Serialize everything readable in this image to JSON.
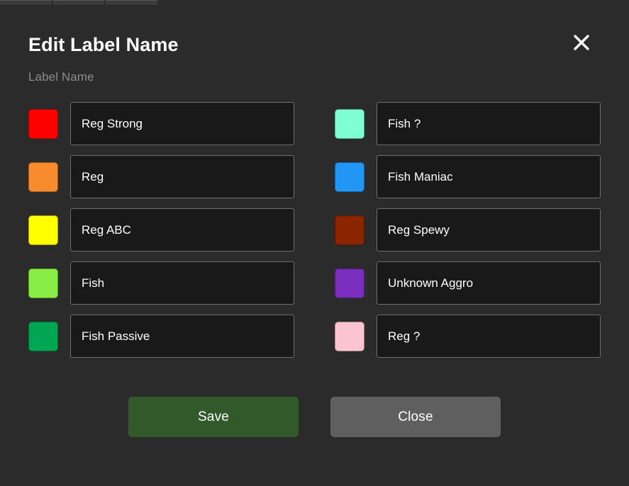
{
  "window": {
    "background_color": "#2b2b2b",
    "top_toolbar_fragment": [
      "",
      "",
      ""
    ]
  },
  "dialog": {
    "title": "Edit Label Name",
    "close_icon": "close-icon",
    "subtitle": "Label Name",
    "labels": [
      {
        "color": "#ff0000",
        "name": "Reg Strong",
        "placeholder": "Label Name"
      },
      {
        "color": "#f78b2e",
        "name": "Reg",
        "placeholder": "Label Name"
      },
      {
        "color": "#ffff00",
        "name": "Reg ABC",
        "placeholder": "Label Name"
      },
      {
        "color": "#88ee44",
        "name": "Fish",
        "placeholder": "Label Name"
      },
      {
        "color": "#00a651",
        "name": "Fish Passive",
        "placeholder": "Label Name"
      },
      {
        "color": "#7fffd4",
        "name": "Fish ?",
        "placeholder": "Label Name"
      },
      {
        "color": "#2196f3",
        "name": "Fish Maniac",
        "placeholder": "Label Name"
      },
      {
        "color": "#8b2500",
        "name": "Reg Spewy",
        "placeholder": "Label Name"
      },
      {
        "color": "#7b2dbe",
        "name": "Unknown Aggro",
        "placeholder": "Label Name"
      },
      {
        "color": "#fbc4d0",
        "name": "Reg ?",
        "placeholder": "Label Name"
      }
    ],
    "buttons": {
      "save_label": "Save",
      "save_color": "#31592a",
      "close_label": "Close",
      "close_color": "#5f5f5f"
    }
  }
}
